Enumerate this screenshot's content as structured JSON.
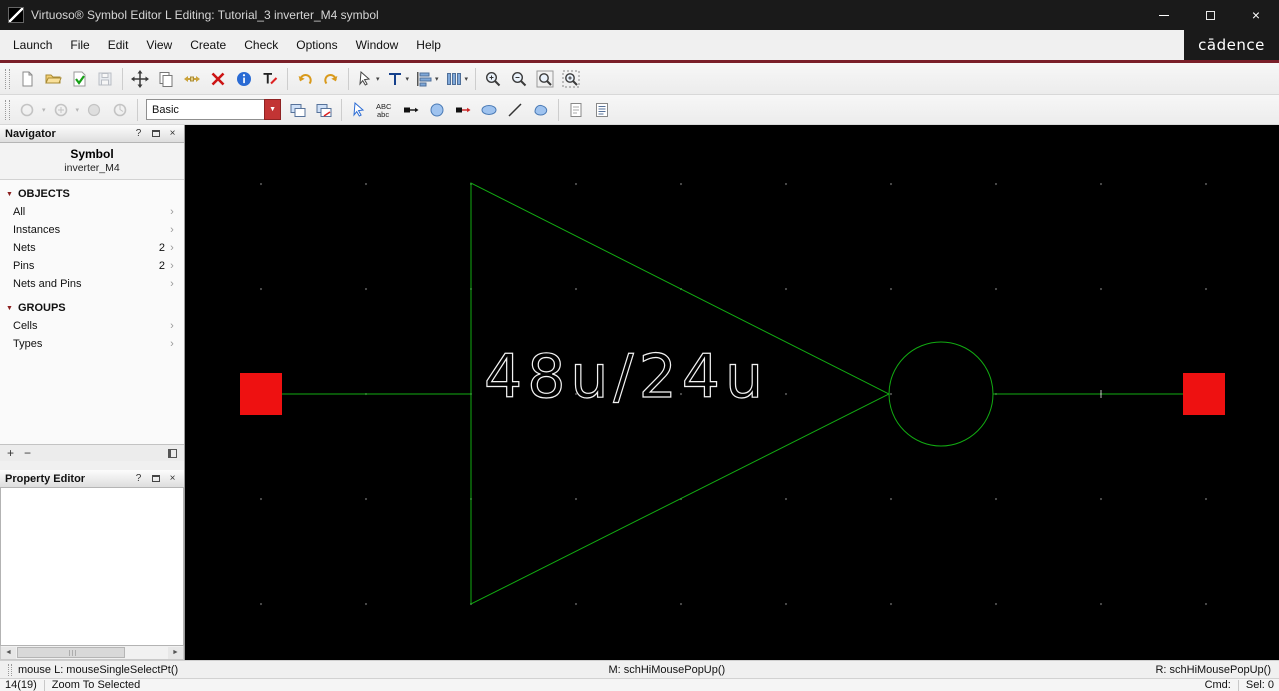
{
  "titlebar": {
    "title": "Virtuoso® Symbol Editor L Editing: Tutorial_3 inverter_M4 symbol"
  },
  "brand": {
    "logo": "cādence"
  },
  "menubar": {
    "items": [
      "Launch",
      "File",
      "Edit",
      "View",
      "Create",
      "Check",
      "Options",
      "Window",
      "Help"
    ]
  },
  "toolbar_row1": {
    "buttons": [
      "new",
      "open",
      "check-and-save",
      "save",
      "move",
      "copy",
      "stretch",
      "delete",
      "properties",
      "edit-labels",
      "undo",
      "redo",
      "selection-mode",
      "add-text",
      "align",
      "distribute",
      "zoom-in",
      "zoom-out",
      "zoom-to-fit",
      "zoom-to-selected"
    ]
  },
  "toolbar_row2": {
    "layer_combo": {
      "value": "Basic"
    },
    "buttons": [
      "history-circle-1",
      "history-circle-2",
      "history-circle-3",
      "history-circle-4",
      "layer-purpose-combo",
      "stacked-squares",
      "stacked-squares-arrow",
      "pointer-select",
      "text-case",
      "pin",
      "circle-shape",
      "pin-red",
      "ellipse-shape",
      "line-shape",
      "polygon-shape",
      "note",
      "document-lines"
    ]
  },
  "navigator": {
    "title": "Navigator",
    "cell_view_type": "Symbol",
    "cell_name": "inverter_M4",
    "objects": {
      "header": "OBJECTS",
      "items": [
        {
          "label": "All",
          "count": ""
        },
        {
          "label": "Instances",
          "count": ""
        },
        {
          "label": "Nets",
          "count": "2"
        },
        {
          "label": "Pins",
          "count": "2"
        },
        {
          "label": "Nets and Pins",
          "count": ""
        }
      ]
    },
    "groups": {
      "header": "GROUPS",
      "items": [
        {
          "label": "Cells",
          "count": ""
        },
        {
          "label": "Types",
          "count": ""
        }
      ]
    }
  },
  "property_editor": {
    "title": "Property Editor"
  },
  "canvas": {
    "device_label": "48u/24u",
    "colors": {
      "background": "#000000",
      "symbol_stroke": "#12ab12",
      "pin_fill": "#ee1111",
      "label": "#f2f2f2",
      "grid_dot": "#4d4d4d"
    }
  },
  "statusbar": {
    "left": "mouse L: mouseSingleSelectPt()",
    "middle": "M: schHiMousePopUp()",
    "right": "R: schHiMousePopUp()"
  },
  "commandbar": {
    "counter": "14(19)",
    "hint": "Zoom To Selected",
    "cmd": "Cmd:",
    "sel": "Sel: 0"
  },
  "icons": {
    "help": "?",
    "close": "×",
    "minimize": "–",
    "section_marker": "▼",
    "row_arrow": "›",
    "combo_arrow": "▼",
    "dropdown": "▾",
    "plus": "+",
    "minus": "−",
    "scroll_left": "◄",
    "scroll_right": "►",
    "abc_upper": "ABC",
    "abc_lower": "abc"
  }
}
